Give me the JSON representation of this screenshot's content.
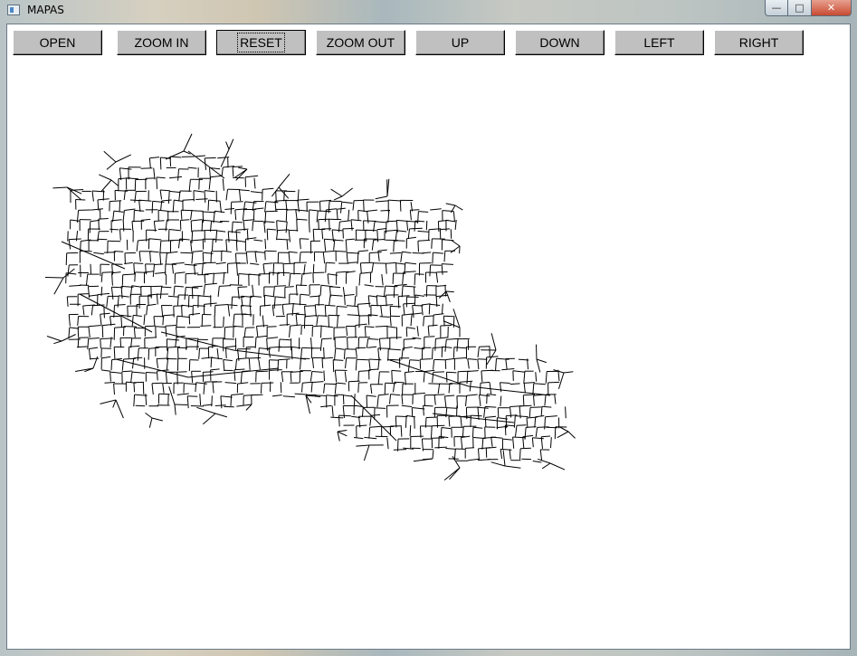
{
  "window": {
    "title": "MAPAS",
    "controls": {
      "minimize": "—",
      "maximize": "□",
      "close": "✕"
    }
  },
  "toolbar": {
    "buttons": [
      {
        "id": "open",
        "label": "OPEN"
      },
      {
        "id": "zoom-in",
        "label": "ZOOM IN"
      },
      {
        "id": "reset",
        "label": "RESET"
      },
      {
        "id": "zoom-out",
        "label": "ZOOM OUT"
      },
      {
        "id": "up",
        "label": "UP"
      },
      {
        "id": "down",
        "label": "DOWN"
      },
      {
        "id": "left",
        "label": "LEFT"
      },
      {
        "id": "right",
        "label": "RIGHT"
      }
    ],
    "focused": "reset"
  },
  "map": {
    "stroke_color": "#000000",
    "background": "#ffffff"
  }
}
